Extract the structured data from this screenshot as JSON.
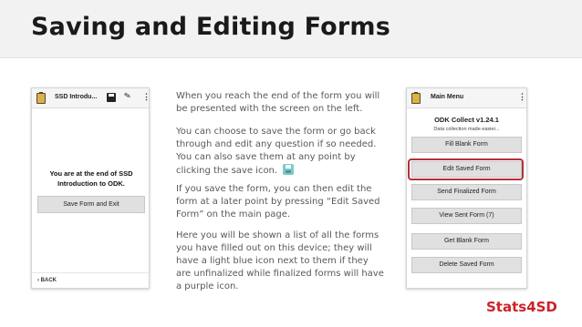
{
  "slide": {
    "title": "Saving and Editing Forms",
    "brand": "Stats4SD"
  },
  "left_phone": {
    "title": "SSD Introdu...",
    "menu_glyph": "⋮",
    "end_message": "You are at the end of SSD Introduction to ODK.",
    "save_exit_label": "Save Form and Exit",
    "back_label": "‹  BACK"
  },
  "paragraphs": [
    "When you reach the end of the form you will be presented with the screen on the left.",
    "You can choose to save the form or go back through and edit any question if so needed. You can also save them at any point by clicking the save icon.",
    "If you save the form, you can then edit the form at a later point by pressing “Edit Saved Form” on the main page.",
    "Here you will be shown a list of all the forms you have filled out on this device; they will have a light blue icon next to them if they are unfinalized while finalized forms will have a purple icon."
  ],
  "right_phone": {
    "title": "Main Menu",
    "menu_glyph": "⋮",
    "version": "ODK Collect v1.24.1",
    "tagline": "Data collection made easier...",
    "buttons": [
      "Fill Blank Form",
      "Edit Saved Form",
      "Send Finalized Form",
      "View Sent Form (7)",
      "Get Blank Form",
      "Delete Saved Form"
    ]
  },
  "colors": {
    "brand": "#cc2229",
    "highlight": "#b5303a",
    "save_icon_inline": "#7ec9c9"
  }
}
